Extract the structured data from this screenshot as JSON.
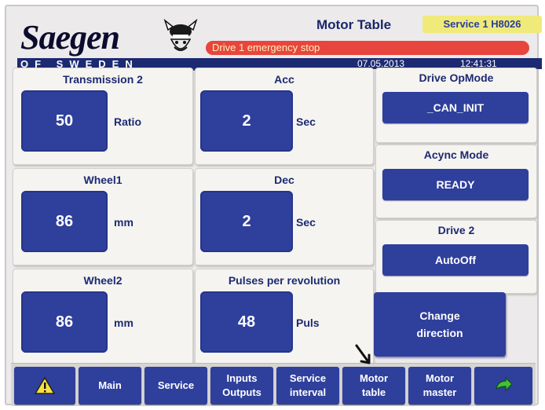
{
  "header": {
    "logo_text": "Saegen",
    "logo_sub": "OF SWEDEN",
    "title": "Motor Table",
    "service_badge": "Service 1 H8026",
    "alarm": "Drive 1 emergency stop",
    "date": "07.05.2013",
    "time": "12:41:31"
  },
  "panels": {
    "transmission2": {
      "title": "Transmission 2",
      "value": "50",
      "unit": "Ratio"
    },
    "acc": {
      "title": "Acc",
      "value": "2",
      "unit": "Sec"
    },
    "wheel1": {
      "title": "Wheel1",
      "value": "86",
      "unit": "mm"
    },
    "dec": {
      "title": "Dec",
      "value": "2",
      "unit": "Sec"
    },
    "wheel2": {
      "title": "Wheel2",
      "value": "86",
      "unit": "mm"
    },
    "pulses": {
      "title": "Pulses per revolution",
      "value": "48",
      "unit": "Puls"
    }
  },
  "right": {
    "drive_opmode": {
      "title": "Drive OpMode",
      "value": "_CAN_INIT"
    },
    "async_mode": {
      "title": "Acync Mode",
      "value": "READY"
    },
    "drive2": {
      "title": "Drive 2",
      "value": "AutoOff"
    },
    "change_direction_line1": "Change",
    "change_direction_line2": "direction"
  },
  "toolbar": {
    "main": "Main",
    "service": "Service",
    "inputs_line1": "Inputs",
    "inputs_line2": "Outputs",
    "service_interval_line1": "Service",
    "service_interval_line2": "interval",
    "motor_table_line1": "Motor",
    "motor_table_line2": "table",
    "motor_master_line1": "Motor",
    "motor_master_line2": "master"
  },
  "icons": {
    "warning": "warning-icon",
    "next": "next-arrow-icon",
    "pointer": "mouse-pointer-icon"
  },
  "colors": {
    "primary_blue": "#2f3f9c",
    "alarm_red": "#e8453f",
    "badge_yellow": "#f0ea7a",
    "panel_bg": "#f6f4f0"
  }
}
